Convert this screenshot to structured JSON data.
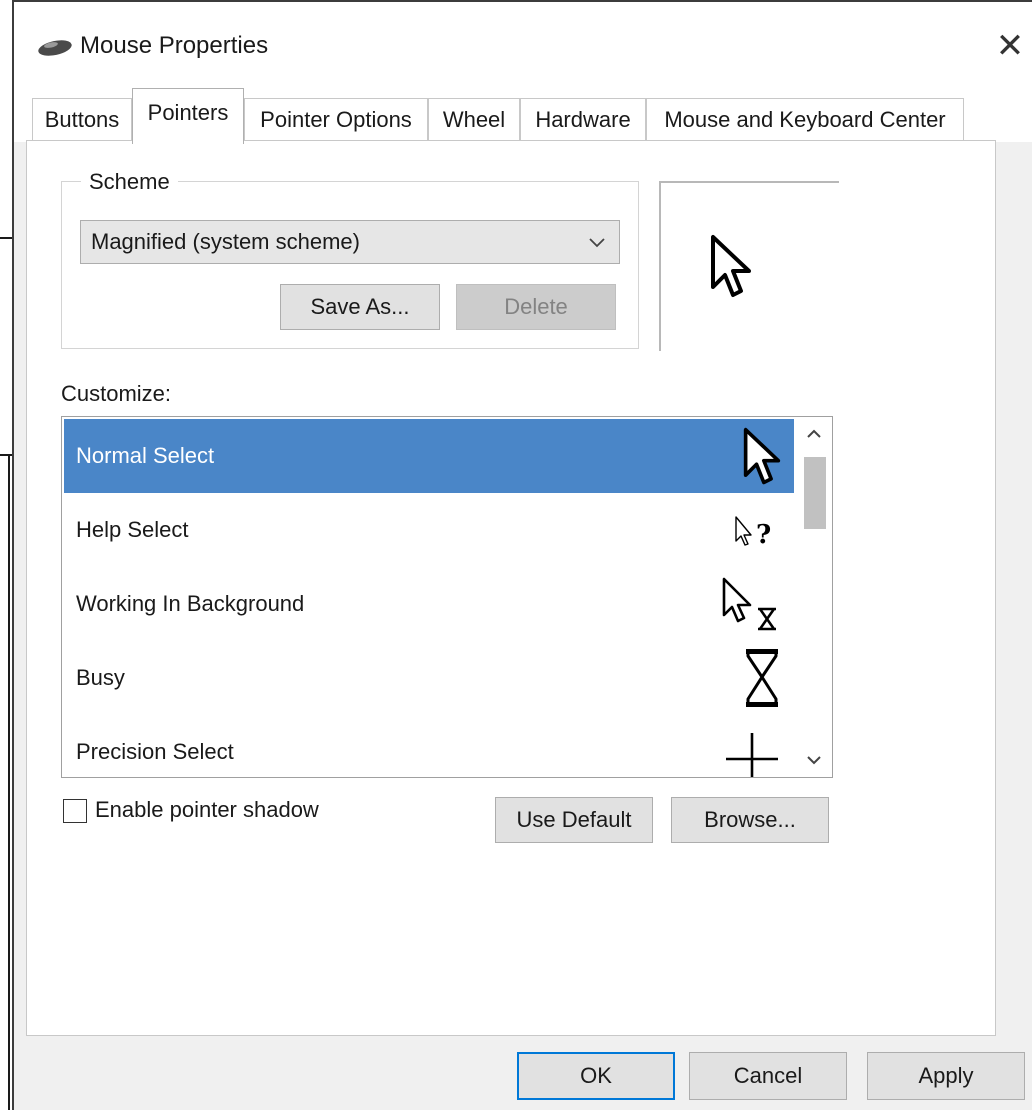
{
  "window": {
    "title": "Mouse Properties",
    "close_glyph": "✕",
    "title_icon": "mouse-icon"
  },
  "tabs": [
    {
      "label": "Buttons",
      "selected": false
    },
    {
      "label": "Pointers",
      "selected": true
    },
    {
      "label": "Pointer Options",
      "selected": false
    },
    {
      "label": "Wheel",
      "selected": false
    },
    {
      "label": "Hardware",
      "selected": false
    },
    {
      "label": "Mouse and Keyboard Center",
      "selected": false
    }
  ],
  "scheme": {
    "group_label": "Scheme",
    "selected_value": "Magnified (system scheme)",
    "save_as_label": "Save As...",
    "delete_label": "Delete",
    "delete_enabled": false
  },
  "preview": {
    "cursor_icon": "arrow-cursor-icon"
  },
  "customize": {
    "label": "Customize:",
    "items": [
      {
        "label": "Normal Select",
        "icon": "arrow-cursor-icon",
        "selected": true
      },
      {
        "label": "Help Select",
        "icon": "help-cursor-icon",
        "selected": false
      },
      {
        "label": "Working In Background",
        "icon": "working-cursor-icon",
        "selected": false
      },
      {
        "label": "Busy",
        "icon": "hourglass-cursor-icon",
        "selected": false
      },
      {
        "label": "Precision Select",
        "icon": "crosshair-cursor-icon",
        "selected": false
      }
    ]
  },
  "options": {
    "enable_pointer_shadow_label": "Enable pointer shadow",
    "enable_pointer_shadow_checked": false,
    "use_default_label": "Use Default",
    "browse_label": "Browse..."
  },
  "footer": {
    "ok_label": "OK",
    "cancel_label": "Cancel",
    "apply_label": "Apply"
  },
  "colors": {
    "selection": "#4a86c8",
    "focus_border": "#0078d7"
  }
}
